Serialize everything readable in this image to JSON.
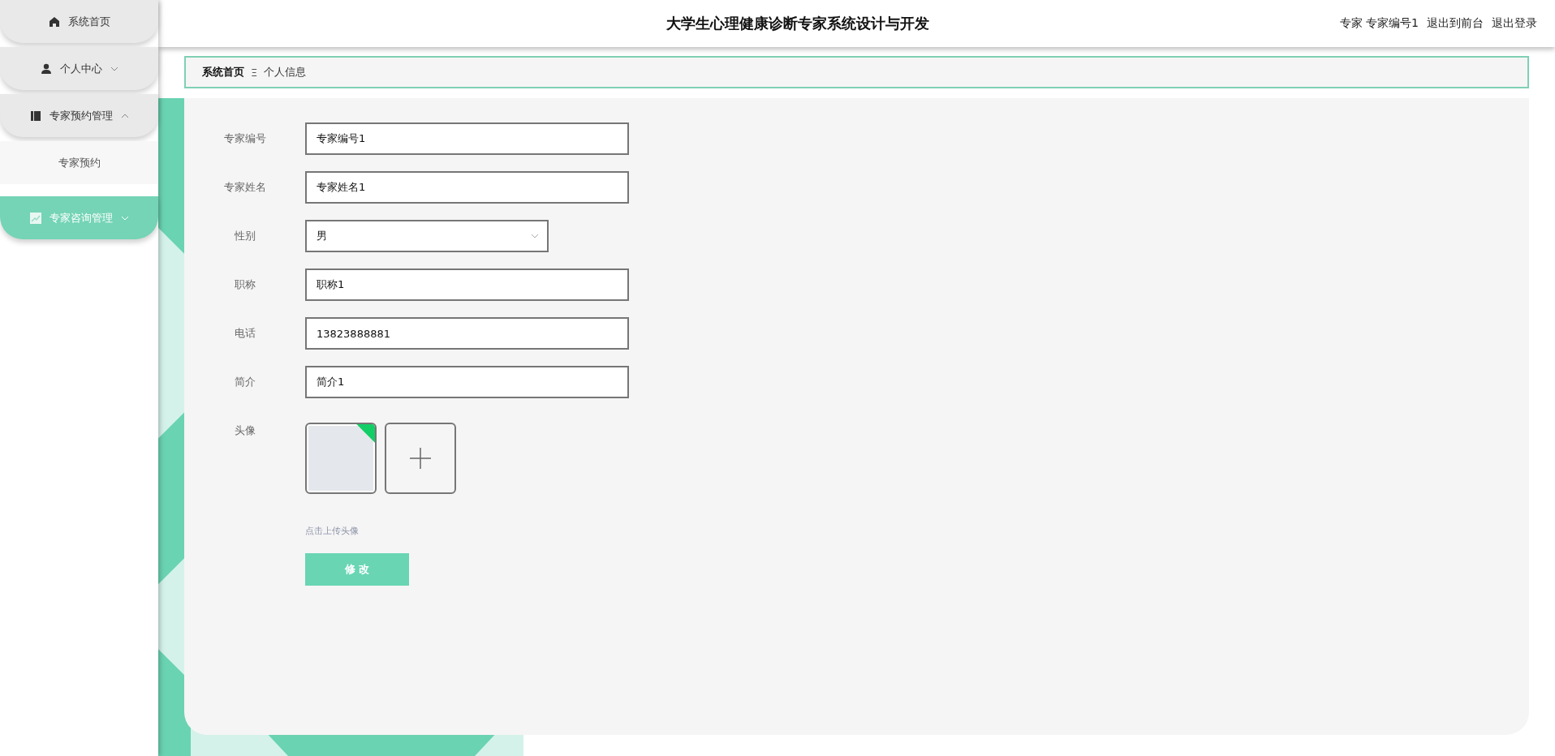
{
  "sidebar": {
    "items": [
      {
        "label": "系统首页",
        "selected": false
      },
      {
        "label": "个人中心",
        "selected": false,
        "expanded": false
      },
      {
        "label": "专家预约管理",
        "selected": false,
        "expanded": true,
        "children": [
          {
            "label": "专家预约",
            "selected": false
          }
        ]
      },
      {
        "label": "专家咨询管理",
        "selected": true,
        "expanded": false
      }
    ]
  },
  "header": {
    "title": "大学生心理健康诊断专家系统设计与开发",
    "user_role": "专家",
    "user_name": "专家编号1",
    "links": [
      "退出到前台",
      "退出登录"
    ]
  },
  "breadcrumb": {
    "items": [
      "系统首页",
      "个人信息"
    ],
    "separator": "Ξ"
  },
  "form": {
    "fields": [
      {
        "kind": "text",
        "label": "专家编号",
        "value": "专家编号1"
      },
      {
        "kind": "text",
        "label": "专家姓名",
        "value": "专家姓名1"
      },
      {
        "kind": "select",
        "label": "性别",
        "value": "男"
      },
      {
        "kind": "text",
        "label": "职称",
        "value": "职称1"
      },
      {
        "kind": "text",
        "label": "电话",
        "value": "13823888881"
      },
      {
        "kind": "text",
        "label": "简介",
        "value": "简介1"
      },
      {
        "kind": "upload",
        "label": "头像",
        "uploaded": true,
        "hint": "点击上传头像"
      }
    ],
    "submit": "修 改"
  }
}
